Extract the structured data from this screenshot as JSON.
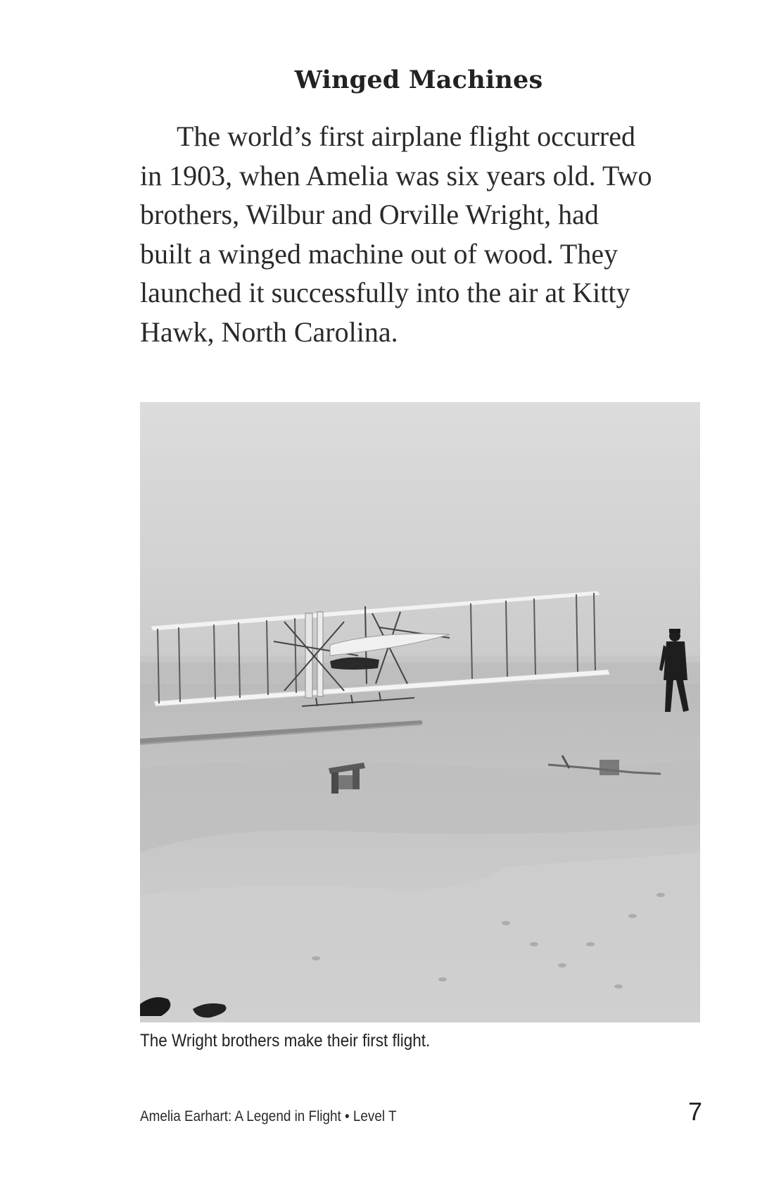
{
  "heading": "Winged Machines",
  "paragraph_lines": [
    "The world’s first airplane flight occurred",
    "in 1903, when Amelia was six years old. Two",
    "brothers, Wilbur and Orville Wright, had",
    "built a winged machine out of wood. They",
    "launched it successfully into the air at Kitty",
    "Hawk, North Carolina."
  ],
  "photo": {
    "caption": "The Wright brothers make their first flight."
  },
  "footer": {
    "book_title": "Amelia Earhart: A Legend in Flight • Level T",
    "page_number": "7"
  }
}
